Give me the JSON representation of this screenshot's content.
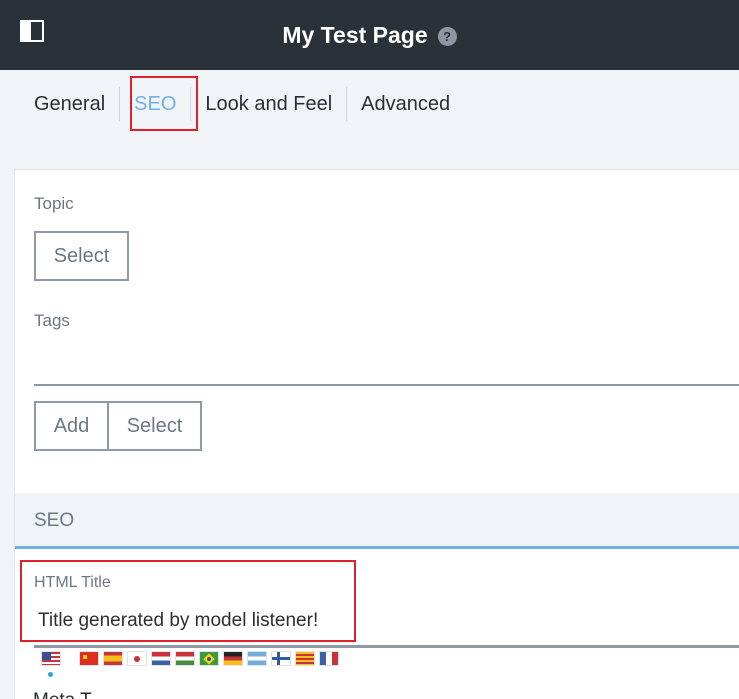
{
  "header": {
    "title": "My Test Page",
    "help_icon": "?"
  },
  "tabs": [
    {
      "label": "General",
      "active": false
    },
    {
      "label": "SEO",
      "active": true
    },
    {
      "label": "Look and Feel",
      "active": false
    },
    {
      "label": "Advanced",
      "active": false
    }
  ],
  "topic": {
    "label": "Topic",
    "select_label": "Select"
  },
  "tags": {
    "label": "Tags",
    "add_label": "Add",
    "select_label": "Select"
  },
  "seo_section": {
    "label": "SEO"
  },
  "html_title": {
    "label": "HTML Title",
    "value": "Title generated by model listener!"
  },
  "languages": [
    "en-US",
    "zh-CN",
    "es-ES",
    "ja-JP",
    "nl-NL",
    "hu-HU",
    "pt-BR",
    "de-DE",
    "ar-SA",
    "fi-FI",
    "ca-ES",
    "fr-FR"
  ],
  "meta_partial": "Meta T",
  "colors": {
    "header_bg": "#2b3138",
    "accent": "#6fb1e3",
    "highlight": "#e0202a"
  }
}
